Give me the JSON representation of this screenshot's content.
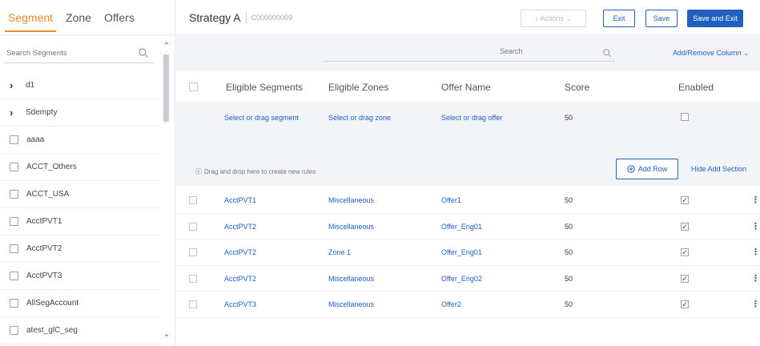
{
  "left": {
    "tabs": [
      {
        "label": "Segment",
        "active": true
      },
      {
        "label": "Zone",
        "active": false
      },
      {
        "label": "Offers",
        "active": false
      }
    ],
    "search": {
      "placeholder": "Search Segments"
    },
    "items": [
      {
        "label": "d1",
        "type": "group"
      },
      {
        "label": "Sdempty",
        "type": "group"
      },
      {
        "label": "aaaa",
        "type": "check"
      },
      {
        "label": "ACCT_Others",
        "type": "check"
      },
      {
        "label": "ACCT_USA",
        "type": "check"
      },
      {
        "label": "AcctPVT1",
        "type": "check"
      },
      {
        "label": "AcctPVT2",
        "type": "check"
      },
      {
        "label": "AcctPVT3",
        "type": "check"
      },
      {
        "label": "AllSegAccount",
        "type": "check"
      },
      {
        "label": "atest_glC_seg",
        "type": "check"
      }
    ]
  },
  "header": {
    "title": "Strategy A",
    "id": "C000000009",
    "actions_label": "↕ Actions ⌄",
    "exit_label": "Exit",
    "save_label": "Save",
    "save_exit_label": "Save and Exit"
  },
  "toolbar": {
    "search_placeholder": "Search",
    "add_remove_label": "Add/Remove Column ⌄"
  },
  "table": {
    "columns": [
      "Eligible Segments",
      "Eligible Zones",
      "Offer Name",
      "Score",
      "Enabled"
    ],
    "add_row": {
      "segment_placeholder": "Select or drag segment",
      "zone_placeholder": "Select or drag zone",
      "offer_placeholder": "Select or drag offer",
      "score": "50",
      "drop_note": "Drag and drop here to create new rules",
      "add_button": "Add Row",
      "hide_link": "Hide Add Section"
    },
    "rows": [
      {
        "segment": "AcctPVT1",
        "zone": "Miscellaneous",
        "offer": "Offer1",
        "score": "50",
        "enabled": true
      },
      {
        "segment": "AcctPVT2",
        "zone": "Miscellaneous",
        "offer": "Offer_Eng01",
        "score": "50",
        "enabled": true
      },
      {
        "segment": "AcctPVT2",
        "zone": "Zone 1",
        "offer": "Offer_Eng01",
        "score": "50",
        "enabled": true
      },
      {
        "segment": "AcctPVT2",
        "zone": "Miscellaneous",
        "offer": "Offer_Eng02",
        "score": "50",
        "enabled": true
      },
      {
        "segment": "AcctPVT3",
        "zone": "Miscellaneous",
        "offer": "Offer2",
        "score": "50",
        "enabled": true
      }
    ]
  },
  "colors": {
    "accent": "#f08a24",
    "primary": "#1f5fbf"
  }
}
